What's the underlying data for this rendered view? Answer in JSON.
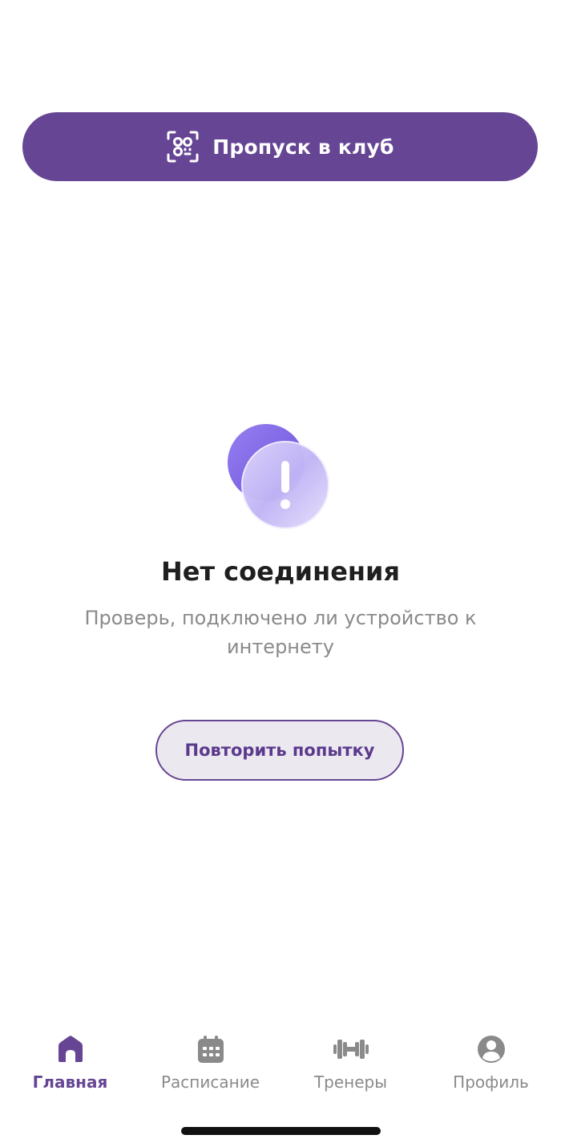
{
  "club_pass": {
    "label": "Пропуск в клуб",
    "icon": "qr-scan-icon"
  },
  "empty_state": {
    "icon": "alert-icon",
    "title": "Нет соединения",
    "message": "Проверь, подключено ли устройство к интернету",
    "retry_label": "Повторить попытку"
  },
  "tab_bar": {
    "items": [
      {
        "label": "Главная",
        "icon": "home-icon",
        "active": true
      },
      {
        "label": "Расписание",
        "icon": "calendar-icon",
        "active": false
      },
      {
        "label": "Тренеры",
        "icon": "dumbbell-icon",
        "active": false
      },
      {
        "label": "Профиль",
        "icon": "profile-icon",
        "active": false
      }
    ]
  },
  "colors": {
    "accent": "#664694",
    "accent_light": "#ebe8f0",
    "inactive": "#8a8a8a",
    "illustration_back": "#8a72ea",
    "illustration_front": "#c9bdf7"
  }
}
